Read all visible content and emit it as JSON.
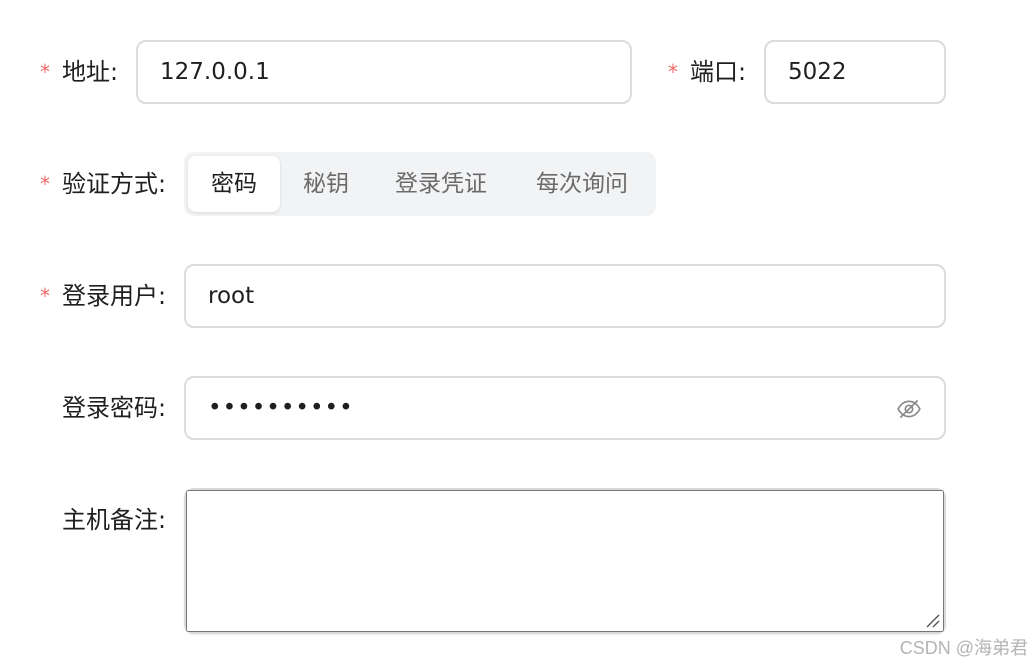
{
  "form": {
    "address": {
      "required_mark": "*",
      "label": "地址:",
      "value": "127.0.0.1"
    },
    "port": {
      "required_mark": "*",
      "label": "端口:",
      "value": "5022"
    },
    "auth": {
      "required_mark": "*",
      "label": "验证方式:",
      "options": [
        "密码",
        "秘钥",
        "登录凭证",
        "每次询问"
      ],
      "selected": "密码"
    },
    "user": {
      "required_mark": "*",
      "label": "登录用户:",
      "value": "root"
    },
    "password": {
      "label": "登录密码:",
      "masked_value": "••••••••••",
      "toggle_icon": "eye-off-icon"
    },
    "remark": {
      "label": "主机备注:",
      "value": ""
    }
  },
  "watermark": "CSDN @海弟君",
  "colors": {
    "required": "#f56c6c",
    "border": "#dcdcdc",
    "segment_bg": "#f2f3f5",
    "muted_text": "#6b6b6b"
  }
}
